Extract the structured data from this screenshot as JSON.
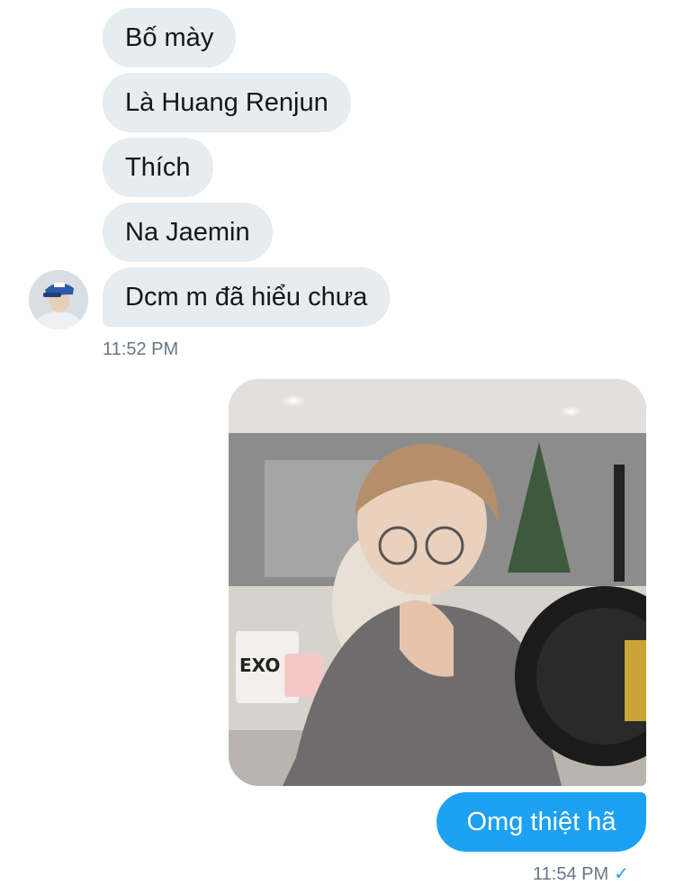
{
  "messages_in": [
    {
      "text": "Bố mày"
    },
    {
      "text": "Là Huang Renjun"
    },
    {
      "text": "Thích"
    },
    {
      "text": "Na Jaemin"
    },
    {
      "text": "Dcm m đã hiểu chưa"
    }
  ],
  "time_in": "11:52 PM",
  "photo": {
    "alt_text": "EXO"
  },
  "message_out": {
    "text": "Omg thiệt hã"
  },
  "time_out": "11:54 PM",
  "read_icon": "checkmark-icon",
  "colors": {
    "incoming_bubble": "#e6ecf0",
    "outgoing_bubble": "#1da1f2",
    "timestamp": "#657786"
  }
}
